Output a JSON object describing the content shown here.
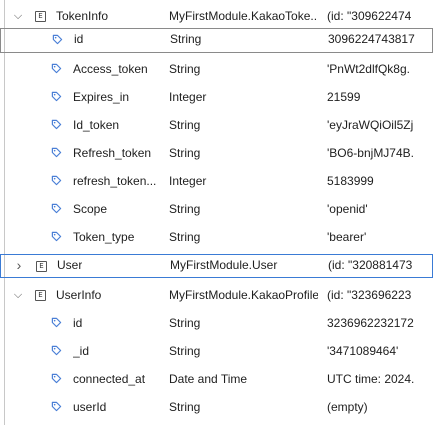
{
  "rows": [
    {
      "name": "TokenInfo",
      "type": "MyFirstModule.KakaoToke...",
      "value": "(id: \"309622474"
    },
    {
      "name": "id",
      "type": "String",
      "value": "3096224743817"
    },
    {
      "name": "Access_token",
      "type": "String",
      "value": "'PnWt2dlfQk8g."
    },
    {
      "name": "Expires_in",
      "type": "Integer",
      "value": "21599"
    },
    {
      "name": "Id_token",
      "type": "String",
      "value": "'eyJraWQiOil5Zj"
    },
    {
      "name": "Refresh_token",
      "type": "String",
      "value": "'BO6-bnjMJ74B."
    },
    {
      "name": "refresh_token...",
      "type": "Integer",
      "value": "5183999"
    },
    {
      "name": "Scope",
      "type": "String",
      "value": "'openid'"
    },
    {
      "name": "Token_type",
      "type": "String",
      "value": "'bearer'"
    },
    {
      "name": "User",
      "type": "MyFirstModule.User",
      "value": "(id: \"320881473"
    },
    {
      "name": "UserInfo",
      "type": "MyFirstModule.KakaoProfile",
      "value": "(id: \"323696223"
    },
    {
      "name": "id",
      "type": "String",
      "value": "3236962232172"
    },
    {
      "name": "_id",
      "type": "String",
      "value": "'3471089464'"
    },
    {
      "name": "connected_at",
      "type": "Date and Time",
      "value": "UTC time: 2024."
    },
    {
      "name": "userId",
      "type": "String",
      "value": "(empty)"
    }
  ],
  "icons": {
    "expanded": "chevron-down-icon",
    "collapsed": "chevron-right-icon",
    "entity": "entity-icon",
    "attribute": "attribute-tag-icon"
  },
  "entity_icon_glyph": "E",
  "chevron_down_glyph": "⌵",
  "chevron_right_glyph": "›",
  "colors": {
    "selection_border": "#8a8a8a",
    "highlight_border": "#3a7bd5",
    "attribute_icon": "#4a7fd6"
  }
}
